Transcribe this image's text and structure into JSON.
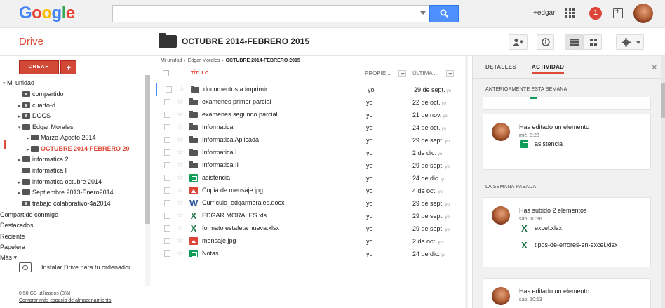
{
  "header": {
    "logo_letters": [
      {
        "ch": "G",
        "color": "#4285f4"
      },
      {
        "ch": "o",
        "color": "#ea4335"
      },
      {
        "ch": "o",
        "color": "#fbbc05"
      },
      {
        "ch": "g",
        "color": "#4285f4"
      },
      {
        "ch": "l",
        "color": "#34a853"
      },
      {
        "ch": "e",
        "color": "#ea4335"
      }
    ],
    "search_placeholder": "",
    "user_name": "+edgar",
    "notification_count": "1"
  },
  "app": {
    "title": "Drive",
    "folder_title": "OCTUBRE 2014-FEBRERO 2015"
  },
  "sidebar": {
    "crear_label": "CREAR",
    "tree": [
      {
        "label": "Mi unidad",
        "arrow": "▾",
        "folder": false
      },
      {
        "label": "compartido",
        "arrow": "",
        "folder": "shared"
      },
      {
        "label": "cuarto-d",
        "arrow": "▸",
        "folder": "shared"
      },
      {
        "label": "DOCS",
        "arrow": "▸",
        "folder": "shared"
      },
      {
        "label": "Edgar Morales",
        "arrow": "▾",
        "folder": "plain"
      },
      {
        "label": "Marzo-Agosto 2014",
        "arrow": "▸",
        "folder": "plain"
      },
      {
        "label": "OCTUBRE 2014-FEBRERO 20",
        "arrow": "▸",
        "folder": "plain",
        "active": true
      },
      {
        "label": "informatica 2",
        "arrow": "▸",
        "folder": "plain"
      },
      {
        "label": "informatica I",
        "arrow": "",
        "folder": "plain"
      },
      {
        "label": "informatica octubre 2014",
        "arrow": "▸",
        "folder": "plain"
      },
      {
        "label": "Septiembre 2013-Enero2014",
        "arrow": "▸",
        "folder": "plain"
      },
      {
        "label": "trabajo colaborativo-4a2014",
        "arrow": "",
        "folder": "shared"
      },
      {
        "label": "Compartido conmigo",
        "arrow": "",
        "folder": false
      },
      {
        "label": "Destacados",
        "arrow": "",
        "folder": false
      },
      {
        "label": "Reciente",
        "arrow": "",
        "folder": false
      },
      {
        "label": "Papelera",
        "arrow": "",
        "folder": false
      },
      {
        "label": "Más ▾",
        "arrow": "",
        "folder": false
      }
    ],
    "install_label": "Instalar Drive para tu ordenador",
    "storage_used": "0,58 GB utilizados (3%)",
    "storage_link": "Comprar más espacio de almacenamiento"
  },
  "breadcrumb": {
    "items": [
      "Mi unidad",
      "Edgar Morales",
      "OCTUBRE 2014-FEBRERO 2015"
    ],
    "separator": "›"
  },
  "file_list": {
    "headers": {
      "title": "TÍTULO",
      "owner": "PROPIE...",
      "modified": "ÚLTIMA ..."
    },
    "rows": [
      {
        "name": "documentos a imprimir",
        "type": "folder",
        "owner": "yo",
        "date": "29 de sept.",
        "by": "yo"
      },
      {
        "name": "examenes primer parcial",
        "type": "folder",
        "owner": "yo",
        "date": "22 de oct.",
        "by": "yo"
      },
      {
        "name": "examenes segundo parcial",
        "type": "folder",
        "owner": "yo",
        "date": "21 de nov.",
        "by": "yo"
      },
      {
        "name": "Informatica",
        "type": "folder",
        "owner": "yo",
        "date": "24 de oct.",
        "by": "yo"
      },
      {
        "name": "Informatica Aplicada",
        "type": "folder",
        "owner": "yo",
        "date": "29 de sept.",
        "by": "yo"
      },
      {
        "name": "Informatica I",
        "type": "folder",
        "owner": "yo",
        "date": "2 de dic.",
        "by": "yo"
      },
      {
        "name": "Informatica II",
        "type": "folder",
        "owner": "yo",
        "date": "29 de sept.",
        "by": "yo"
      },
      {
        "name": "asistencia",
        "type": "sheet",
        "owner": "yo",
        "date": "24 de dic.",
        "by": "yo"
      },
      {
        "name": "Copia de mensaje.jpg",
        "type": "image",
        "owner": "yo",
        "date": "4 de oct.",
        "by": "yo"
      },
      {
        "name": "Curriculo_edgarmorales.docx",
        "type": "word",
        "owner": "yo",
        "date": "29 de sept.",
        "by": "yo"
      },
      {
        "name": "EDGAR MORALES.xls",
        "type": "excel",
        "owner": "yo",
        "date": "29 de sept.",
        "by": "yo"
      },
      {
        "name": "formato estafeta nueva.xlsx",
        "type": "excel",
        "owner": "yo",
        "date": "29 de sept.",
        "by": "yo"
      },
      {
        "name": "mensaje.jpg",
        "type": "image",
        "owner": "yo",
        "date": "2 de oct.",
        "by": "yo"
      },
      {
        "name": "Notas",
        "type": "sheet",
        "owner": "yo",
        "date": "24 de dic.",
        "by": "yo"
      }
    ]
  },
  "panel": {
    "tab_details": "DETALLES",
    "tab_activity": "ACTIVIDAD",
    "close": "×",
    "section_earlier_week": "ANTERIORMENTE ESTA SEMANA",
    "section_last_week": "LA SEMANA PASADA",
    "cards": [
      {
        "action": "Has editado un elemento",
        "time": "mié. 8:23",
        "files": [
          {
            "name": "asistencia",
            "type": "sheet"
          }
        ]
      },
      {
        "action": "Has subido 2 elementos",
        "time": "sáb. 10:36",
        "files": [
          {
            "name": "excel.xlsx",
            "type": "excel"
          },
          {
            "name": "tipos-de-errores-en-excel.xlsx",
            "type": "excel"
          }
        ]
      },
      {
        "action": "Has editado un elemento",
        "time": "sáb. 10:13",
        "files": []
      }
    ]
  },
  "icons": {
    "word_glyph": "W",
    "excel_glyph": "X",
    "star_glyph": "☆"
  },
  "colors": {
    "accent_red": "#dd4b39",
    "search_blue": "#4d90fe",
    "sheet_green": "#0f9d58"
  }
}
